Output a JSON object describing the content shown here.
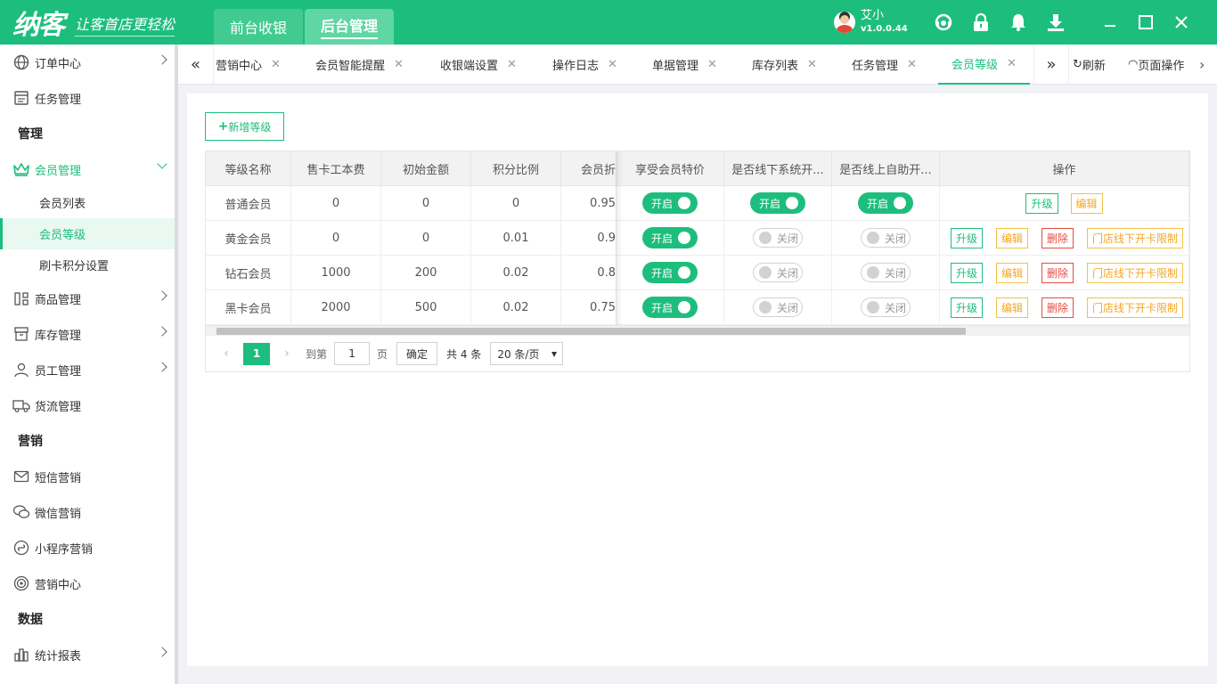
{
  "app": {
    "logo_text": "纳客",
    "slogan": "让客首店更轻松",
    "modules": [
      "前台收银",
      "后台管理"
    ],
    "user_name": "艾小",
    "version": "v1.0.0.44",
    "brand_color": "#1dbe7d"
  },
  "sidebar": {
    "items": [
      {
        "label": "订单中心",
        "icon": "globe-icon"
      },
      {
        "label": "任务管理",
        "icon": "task-icon"
      }
    ],
    "section_manage": "管理",
    "member_mgmt": "会员管理",
    "member_sub": [
      "会员列表",
      "会员等级",
      "刷卡积分设置"
    ],
    "items2": [
      {
        "label": "商品管理",
        "icon": "product-icon"
      },
      {
        "label": "库存管理",
        "icon": "inventory-icon"
      },
      {
        "label": "员工管理",
        "icon": "employee-icon"
      },
      {
        "label": "货流管理",
        "icon": "truck-icon"
      }
    ],
    "section_marketing": "营销",
    "marketing": [
      {
        "label": "短信营销",
        "icon": "mail-icon"
      },
      {
        "label": "微信营销",
        "icon": "wechat-icon"
      },
      {
        "label": "小程序营销",
        "icon": "miniprogram-icon"
      },
      {
        "label": "营销中心",
        "icon": "target-icon"
      }
    ],
    "section_data": "数据",
    "data_items": [
      {
        "label": "统计报表",
        "icon": "chart-icon"
      }
    ]
  },
  "tabs": {
    "items": [
      "营销中心",
      "会员智能提醒",
      "收银端设置",
      "操作日志",
      "单据管理",
      "库存列表",
      "任务管理",
      "会员等级"
    ],
    "refresh": "刷新",
    "page_ops": "页面操作"
  },
  "toolbar": {
    "add_label": "新增等级"
  },
  "table": {
    "headers": [
      "等级名称",
      "售卡工本费",
      "初始金额",
      "积分比例",
      "会员折",
      "享受会员特价",
      "是否线下系统开...",
      "是否线上自助开...",
      "操作"
    ],
    "rows": [
      {
        "name": "普通会员",
        "fee": "0",
        "init": "0",
        "ratio": "0",
        "discount": "0.95",
        "special": "开启",
        "offline": "开启",
        "online": "开启"
      },
      {
        "name": "黄金会员",
        "fee": "0",
        "init": "0",
        "ratio": "0.01",
        "discount": "0.9",
        "special": "开启",
        "offline": "关闭",
        "online": "关闭"
      },
      {
        "name": "钻石会员",
        "fee": "1000",
        "init": "200",
        "ratio": "0.02",
        "discount": "0.8",
        "special": "开启",
        "offline": "关闭",
        "online": "关闭"
      },
      {
        "name": "黑卡会员",
        "fee": "2000",
        "init": "500",
        "ratio": "0.02",
        "discount": "0.75",
        "special": "开启",
        "offline": "关闭",
        "online": "关闭"
      }
    ],
    "ops": {
      "upgrade": "升级",
      "edit": "编辑",
      "delete": "删除",
      "limit": "门店线下开卡限制"
    }
  },
  "pagination": {
    "current": "1",
    "goto_label": "到第",
    "page_input": "1",
    "page_label": "页",
    "confirm": "确定",
    "total": "共 4 条",
    "per_page": "20 条/页"
  }
}
